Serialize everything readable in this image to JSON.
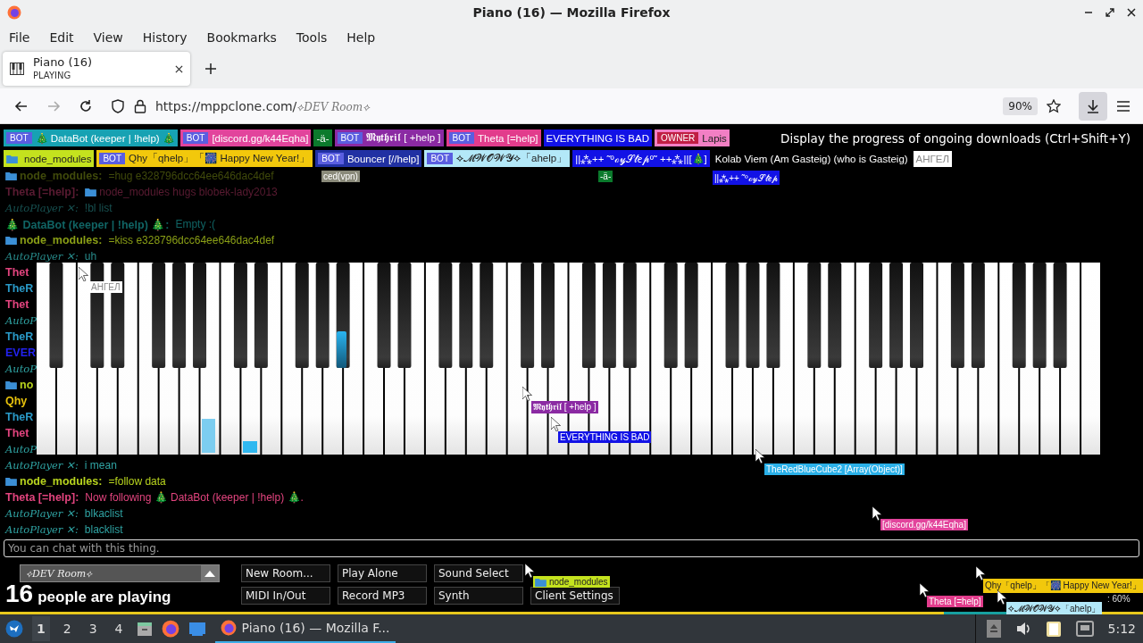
{
  "window": {
    "title": "Piano (16) — Mozilla Firefox"
  },
  "menu": [
    "File",
    "Edit",
    "View",
    "History",
    "Bookmarks",
    "Tools",
    "Help"
  ],
  "tabs": [
    {
      "title": "Piano (16)",
      "subtitle": "PLAYING",
      "selected": true
    }
  ],
  "nav": {
    "url": "https://mppclone.com/",
    "url_room": "⟡DEV Room⟡",
    "zoom": "90%",
    "forward_disabled": true,
    "downloads_active": true
  },
  "tooltip": "Display the progress of ongoing downloads (Ctrl+Shift+Y)",
  "users": [
    [
      {
        "tag": "BOT",
        "name": "🎄 DataBot (keeper | !help) 🎄",
        "color": "#17a2b3"
      },
      {
        "tag": "BOT",
        "name": "[discord.gg/k44Eqha]",
        "color": "#e2449c"
      },
      {
        "name": "-ä-",
        "color": "#0b7a2c"
      },
      {
        "tag": "BOT",
        "name": "𝕸𝖞𝖙𝖍𝖗𝖎𝖑 [ +help ]",
        "color": "#8b2aa3"
      },
      {
        "tag": "BOT",
        "name": "Theta [=help]",
        "color": "#e23c8c"
      },
      {
        "name": "EVERYTHING IS BAD",
        "color": "#1212e6"
      },
      {
        "tag": "OWNER",
        "name": "Lapis",
        "color": "#f27fc4"
      }
    ],
    [
      {
        "name": "node_modules",
        "color": "#c4e21e",
        "folder": true
      },
      {
        "tag": "BOT",
        "name": "Qhy「qhelp」「🎆 Happy New Year!」",
        "color": "#f2c80c"
      },
      {
        "tag": "BOT",
        "name": "Bouncer [//help]",
        "color": "#2131a3"
      },
      {
        "tag": "BOT",
        "name": "⟡𝓜𝓦𝓞𝓦𝓨⟡「ahelp」",
        "color": "#b3e8f8"
      },
      {
        "name": "||⁂++ ˜ºℴ𝓎𝒮𝓉𝑒𝓅º˜ ++⁂||[🎄]",
        "color": "#1212e6"
      },
      {
        "name": "Kolab Viem (Am Gasteig) (who is Gasteig)",
        "color": "#000000"
      },
      {
        "name": "АНГЕЛ",
        "color": "#ffffff"
      }
    ]
  ],
  "chat": [
    {
      "kind": "full",
      "name": "node_modules:",
      "folder": true,
      "text": "=hug e328796dcc64ee646dac4def",
      "color": "#404a0b"
    },
    {
      "kind": "full",
      "name": "Theta [=help]:",
      "text": "node_modules hugs blobek-lady2013",
      "text_folder": true,
      "color": "#5a1b32"
    },
    {
      "kind": "full",
      "name": "AutoPlayer ✕:",
      "script": true,
      "text": "!bl list",
      "color": "#175151"
    },
    {
      "kind": "full",
      "name": "🎄 DataBot (keeper | !help) 🎄:",
      "text": "Empty :(",
      "color": "#106464"
    },
    {
      "kind": "full",
      "name": "node_modules:",
      "folder": true,
      "text": "=kiss e328796dcc64ee646dac4def",
      "color": "#8a9f16"
    },
    {
      "kind": "full",
      "name": "AutoPlayer ✕:",
      "script": true,
      "text": "uh",
      "color": "#288b8b"
    },
    {
      "kind": "cut",
      "name": "Thet",
      "color": "#e2447e"
    },
    {
      "kind": "cut",
      "name": "TheR",
      "color": "#2a9ac8"
    },
    {
      "kind": "cut",
      "name": "Thet",
      "color": "#e2447e"
    },
    {
      "kind": "cut",
      "name": "AutoP",
      "script": true,
      "color": "#2fa3a3"
    },
    {
      "kind": "cut",
      "name": "TheR",
      "color": "#2a9ac8"
    },
    {
      "kind": "cut",
      "name": "EVER",
      "color": "#2222ee"
    },
    {
      "kind": "cut",
      "name": "AutoP",
      "script": true,
      "color": "#2fa3a3"
    },
    {
      "kind": "cut",
      "name": "no",
      "folder": true,
      "color": "#b8d41e"
    },
    {
      "kind": "cut",
      "name": "Qhy",
      "color": "#e8c20c"
    },
    {
      "kind": "cut",
      "name": "TheR",
      "color": "#2a9ac8"
    },
    {
      "kind": "cut",
      "name": "Thet",
      "color": "#e2447e"
    },
    {
      "kind": "cut",
      "name": "AutoP",
      "script": true,
      "color": "#2fa3a3"
    },
    {
      "kind": "full",
      "name": "AutoPlayer ✕:",
      "script": true,
      "text": "i mean",
      "color": "#2fa3a3"
    },
    {
      "kind": "full",
      "name": "node_modules:",
      "folder": true,
      "text": "=follow data",
      "color": "#b8d41e"
    },
    {
      "kind": "full",
      "name": "Theta [=help]:",
      "text": "Now following 🎄 DataBot (keeper | !help) 🎄.",
      "color": "#e2447e"
    },
    {
      "kind": "full",
      "name": "AutoPlayer ✕:",
      "script": true,
      "text": "blkaclist",
      "color": "#2fa3a3"
    },
    {
      "kind": "full",
      "name": "AutoPlayer ✕:",
      "script": true,
      "text": "blacklist",
      "color": "#2fa3a3"
    }
  ],
  "cursors": [
    {
      "label": "ced(vpn)",
      "color": "#8a8a7a"
    },
    {
      "label": "АНГЕЛ",
      "color": "#ffffff"
    },
    {
      "label": "𝕸𝖞𝖙𝖍𝖗𝖎𝖑 [ +help ]",
      "color": "#8b2aa3"
    },
    {
      "label": "EVERYTHING IS BAD",
      "color": "#1212e6"
    },
    {
      "label": "TheRedBlueCube2 [Array(Object)]",
      "color": "#2ab0e8"
    },
    {
      "label": "[discord.gg/k44Eqha]",
      "color": "#e2449c"
    },
    {
      "label": "node_modules",
      "color": "#c4e21e",
      "folder": true
    },
    {
      "label": "Qhy「qhelp」「🎆 Happy New Year!」",
      "color": "#f2c80c"
    },
    {
      "label": "Theta [=help]",
      "color": "#e23c8c"
    },
    {
      "label": "⟡𝓜𝓦𝓞𝓦𝓨⟡「ahelp」",
      "color": "#b3e8f8"
    },
    {
      "label": "-ä-",
      "color": "#0b7a2c"
    },
    {
      "label": "||⁂++ ˜ºℴ𝓎𝒮𝓉𝑒𝓅",
      "color": "#1212e6"
    }
  ],
  "chat_input": {
    "placeholder": "You can chat with this thing."
  },
  "room": {
    "name": "⟡DEV Room⟡"
  },
  "player_count": {
    "number": "16",
    "text": "people are playing"
  },
  "buttons": [
    [
      "New Room...",
      "Play Alone",
      "Sound Select"
    ],
    [
      "MIDI In/Out",
      "Record MP3",
      "Synth",
      "Client Settings"
    ]
  ],
  "volume_note": ": 60%",
  "taskbar": {
    "workspaces": [
      {
        "label": "1",
        "selected": true
      },
      {
        "label": "2",
        "selected": false
      },
      {
        "label": "3",
        "selected": false
      },
      {
        "label": "4",
        "selected": false
      }
    ],
    "tasks": [
      {
        "title": "Piano (16) — Mozilla F...",
        "selected": true
      }
    ],
    "clock": "5:12"
  }
}
